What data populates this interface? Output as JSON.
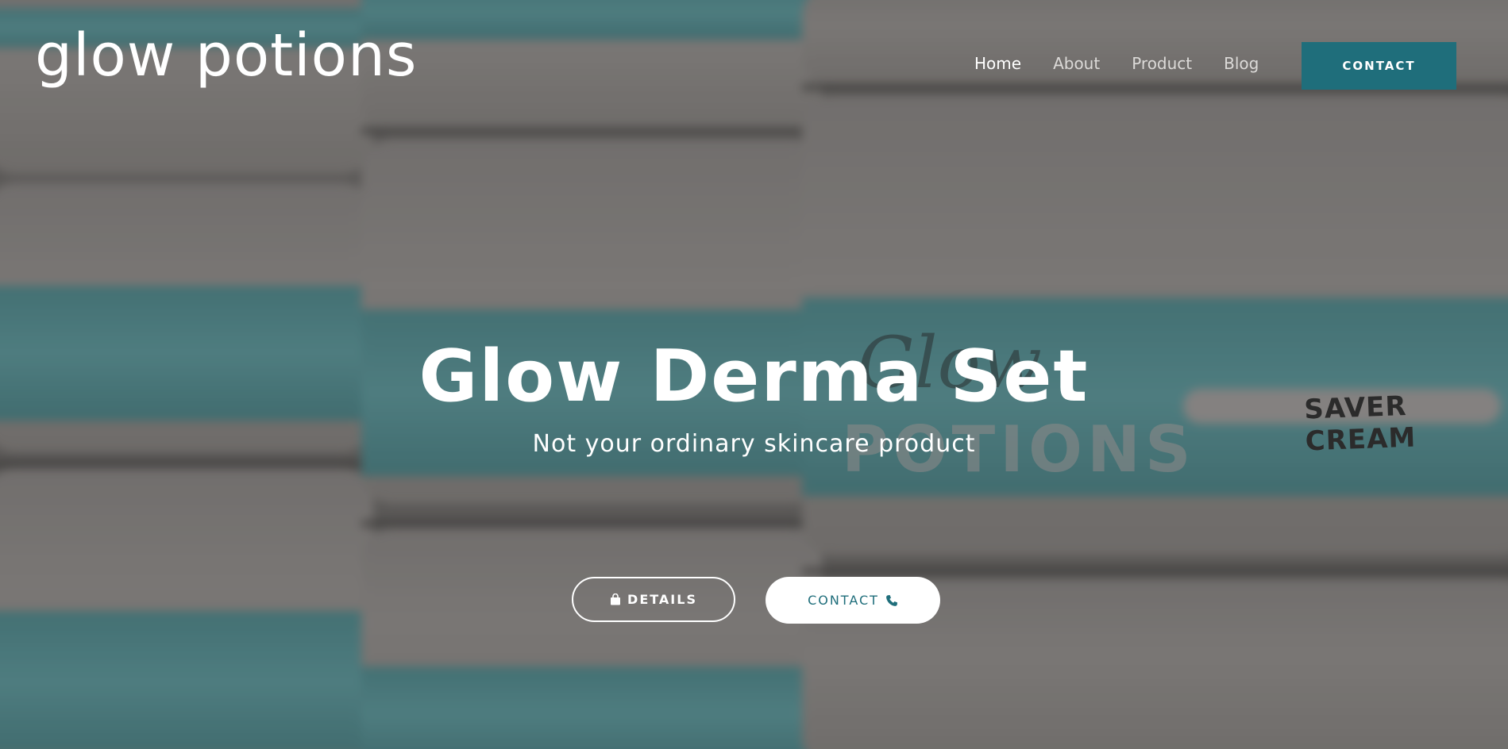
{
  "header": {
    "logo_text": "glow potions",
    "nav": [
      {
        "label": "Home",
        "active": true
      },
      {
        "label": "About",
        "active": false
      },
      {
        "label": "Product",
        "active": false
      },
      {
        "label": "Blog",
        "active": false
      }
    ],
    "contact_label": "CONTACT"
  },
  "hero": {
    "title": "Glow Derma Set",
    "subtitle": "Not your ordinary skincare product",
    "details_label": "DETAILS",
    "details_icon": "shopping-bag-icon",
    "contact_label": "CONTACT",
    "contact_icon": "phone-icon"
  },
  "background": {
    "jar_label_text": "SAVER CREAM",
    "jar_brand_text": "POTIONS"
  },
  "colors": {
    "accent": "#1f6e7b",
    "jar_band": "#5e9ea2"
  }
}
